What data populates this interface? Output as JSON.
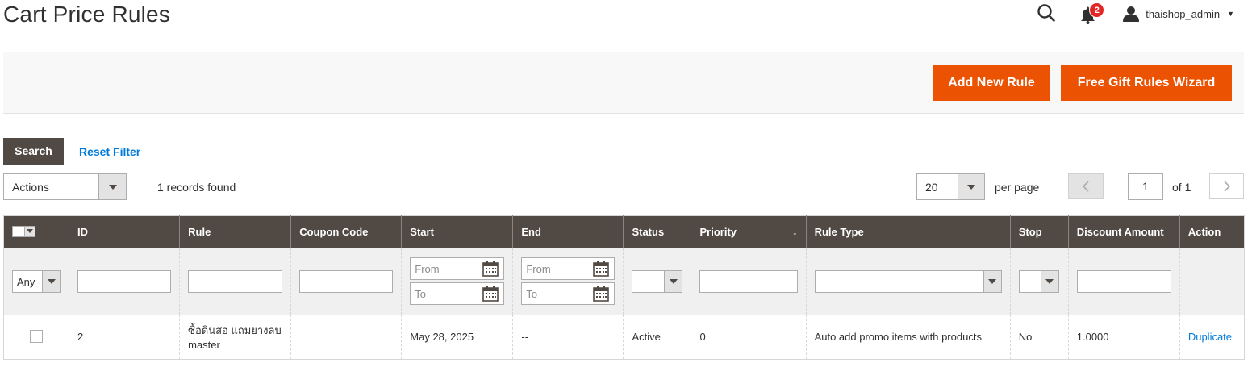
{
  "page": {
    "title": "Cart Price Rules"
  },
  "header": {
    "search_icon": "search-icon",
    "notifications_count": "2",
    "username": "thaishop_admin"
  },
  "toolbar": {
    "add_label": "Add New Rule",
    "gift_label": "Free Gift Rules Wizard",
    "accent": "#eb5202"
  },
  "filters_bar": {
    "search_label": "Search",
    "reset_label": "Reset Filter",
    "actions_value": "Actions",
    "records_found": "1 records found",
    "per_page_value": "20",
    "per_page_label": "per page",
    "page_value": "1",
    "page_of": "of 1"
  },
  "grid": {
    "columns": [
      "ID",
      "Rule",
      "Coupon Code",
      "Start",
      "End",
      "Status",
      "Priority",
      "Rule Type",
      "Stop",
      "Discount Amount",
      "Action"
    ],
    "filters": {
      "any_value": "Any",
      "from_placeholder": "From",
      "to_placeholder": "To"
    },
    "rows": [
      {
        "id": "2",
        "rule_line1": "ซื้อดินสอ แถมยางลบ",
        "rule_line2": "master",
        "coupon": "",
        "start": "May 28, 2025",
        "end": "--",
        "status": "Active",
        "priority": "0",
        "rule_type": "Auto add promo items with products",
        "stop": "No",
        "discount": "1.0000",
        "action": "Duplicate"
      }
    ]
  }
}
